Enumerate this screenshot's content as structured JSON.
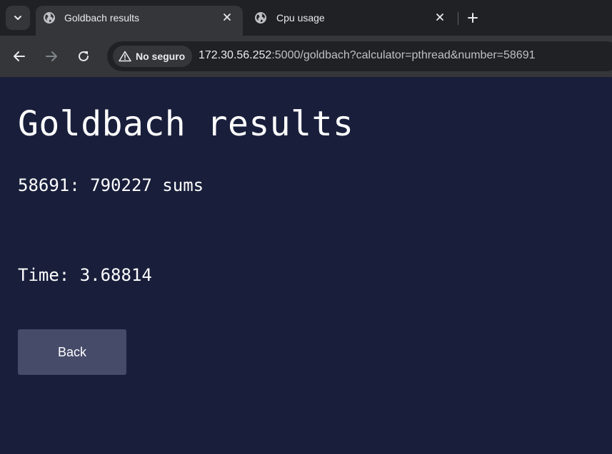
{
  "browser": {
    "tabs": [
      {
        "title": "Goldbach results",
        "active": true
      },
      {
        "title": "Cpu usage",
        "active": false
      }
    ],
    "security_label": "No seguro",
    "url_host": "172.30.56.252",
    "url_rest": ":5000/goldbach?calculator=pthread&number=58691"
  },
  "page": {
    "heading": "Goldbach results",
    "result": "58691: 790227 sums",
    "time": "Time: 3.68814",
    "back_label": "Back"
  },
  "colors": {
    "page_background": "#191f3b",
    "button_background": "#464b6a",
    "text": "#ffffff"
  }
}
